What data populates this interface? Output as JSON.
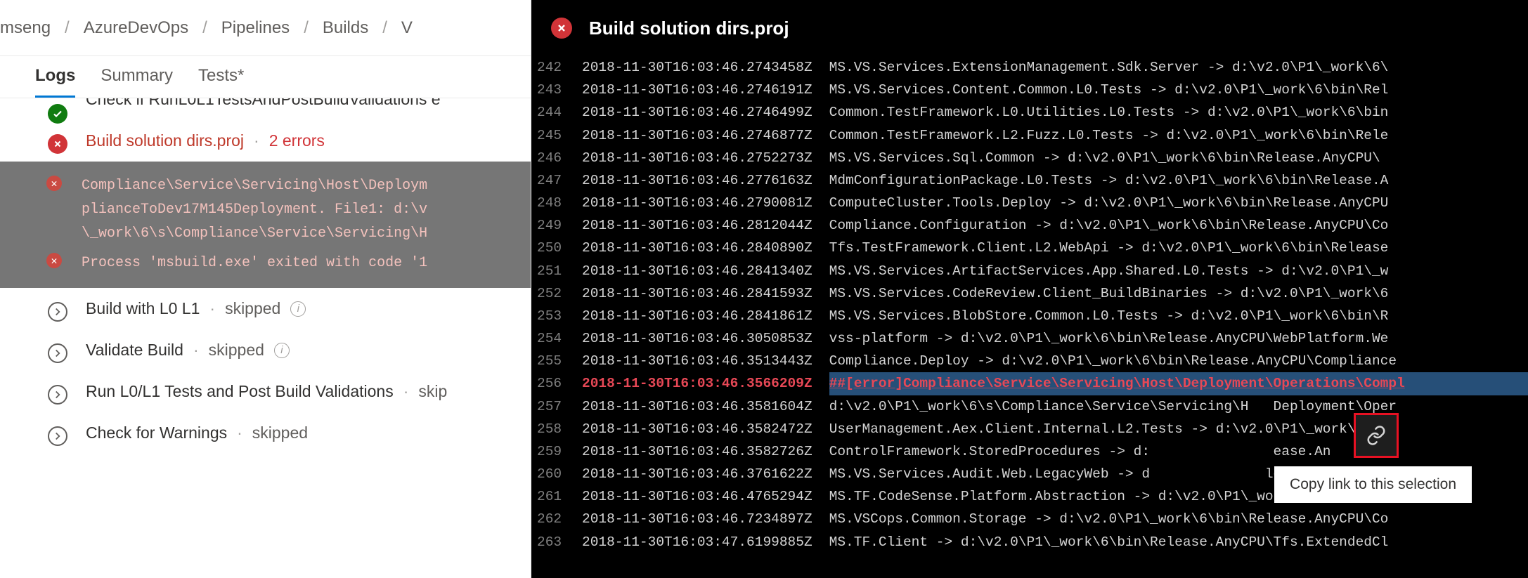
{
  "breadcrumb": [
    "mseng",
    "AzureDevOps",
    "Pipelines",
    "Builds",
    "V"
  ],
  "tabs": {
    "logs": "Logs",
    "summary": "Summary",
    "tests": "Tests*"
  },
  "steps": {
    "cut_prev": "Check if RunL0L1TestsAndPostBuildValidations e",
    "build_solution": {
      "title": "Build solution dirs.proj",
      "errcount": "2 errors"
    },
    "errors": {
      "e1": "Compliance\\Service\\Servicing\\Host\\Deploym\nplianceToDev17M145Deployment. File1: d:\\v\n\\_work\\6\\s\\Compliance\\Service\\Servicing\\H",
      "e2": "Process 'msbuild.exe' exited with code '1"
    },
    "build_l0l1": {
      "title": "Build with L0 L1",
      "status": "skipped"
    },
    "validate_build": {
      "title": "Validate Build",
      "status": "skipped"
    },
    "run_tests": {
      "title": "Run L0/L1 Tests and Post Build Validations",
      "status": "skip"
    },
    "check_warn": {
      "title": "Check for Warnings",
      "status": "skipped"
    }
  },
  "panel_title": "Build solution dirs.proj",
  "log": [
    {
      "n": "242",
      "ts": "2018-11-30T16:03:46.2743458Z",
      "body": "MS.VS.Services.ExtensionManagement.Sdk.Server -> d:\\v2.0\\P1\\_work\\6\\"
    },
    {
      "n": "243",
      "ts": "2018-11-30T16:03:46.2746191Z",
      "body": "MS.VS.Services.Content.Common.L0.Tests -> d:\\v2.0\\P1\\_work\\6\\bin\\Rel"
    },
    {
      "n": "244",
      "ts": "2018-11-30T16:03:46.2746499Z",
      "body": "Common.TestFramework.L0.Utilities.L0.Tests -> d:\\v2.0\\P1\\_work\\6\\bin"
    },
    {
      "n": "245",
      "ts": "2018-11-30T16:03:46.2746877Z",
      "body": "Common.TestFramework.L2.Fuzz.L0.Tests -> d:\\v2.0\\P1\\_work\\6\\bin\\Rele"
    },
    {
      "n": "246",
      "ts": "2018-11-30T16:03:46.2752273Z",
      "body": "MS.VS.Services.Sql.Common -> d:\\v2.0\\P1\\_work\\6\\bin\\Release.AnyCPU\\"
    },
    {
      "n": "247",
      "ts": "2018-11-30T16:03:46.2776163Z",
      "body": "MdmConfigurationPackage.L0.Tests -> d:\\v2.0\\P1\\_work\\6\\bin\\Release.A"
    },
    {
      "n": "248",
      "ts": "2018-11-30T16:03:46.2790081Z",
      "body": "ComputeCluster.Tools.Deploy -> d:\\v2.0\\P1\\_work\\6\\bin\\Release.AnyCPU"
    },
    {
      "n": "249",
      "ts": "2018-11-30T16:03:46.2812044Z",
      "body": "Compliance.Configuration -> d:\\v2.0\\P1\\_work\\6\\bin\\Release.AnyCPU\\Co"
    },
    {
      "n": "250",
      "ts": "2018-11-30T16:03:46.2840890Z",
      "body": "Tfs.TestFramework.Client.L2.WebApi -> d:\\v2.0\\P1\\_work\\6\\bin\\Release"
    },
    {
      "n": "251",
      "ts": "2018-11-30T16:03:46.2841340Z",
      "body": "MS.VS.Services.ArtifactServices.App.Shared.L0.Tests -> d:\\v2.0\\P1\\_w"
    },
    {
      "n": "252",
      "ts": "2018-11-30T16:03:46.2841593Z",
      "body": "MS.VS.Services.CodeReview.Client_BuildBinaries -> d:\\v2.0\\P1\\_work\\6"
    },
    {
      "n": "253",
      "ts": "2018-11-30T16:03:46.2841861Z",
      "body": "MS.VS.Services.BlobStore.Common.L0.Tests -> d:\\v2.0\\P1\\_work\\6\\bin\\R"
    },
    {
      "n": "254",
      "ts": "2018-11-30T16:03:46.3050853Z",
      "body": "vss-platform -> d:\\v2.0\\P1\\_work\\6\\bin\\Release.AnyCPU\\WebPlatform.We"
    },
    {
      "n": "255",
      "ts": "2018-11-30T16:03:46.3513443Z",
      "body": "Compliance.Deploy -> d:\\v2.0\\P1\\_work\\6\\bin\\Release.AnyCPU\\Compliance"
    },
    {
      "n": "256",
      "ts": "2018-11-30T16:03:46.3566209Z",
      "body": "##[error]Compliance\\Service\\Servicing\\Host\\Deployment\\Operations\\Compl",
      "err": true,
      "sel": true
    },
    {
      "n": "257",
      "ts": "2018-11-30T16:03:46.3581604Z",
      "body": "d:\\v2.0\\P1\\_work\\6\\s\\Compliance\\Service\\Servicing\\H   Deployment\\Oper"
    },
    {
      "n": "258",
      "ts": "2018-11-30T16:03:46.3582472Z",
      "body": "UserManagement.Aex.Client.Internal.L2.Tests -> d:\\v2.0\\P1\\_work\\6\\bi"
    },
    {
      "n": "259",
      "ts": "2018-11-30T16:03:46.3582726Z",
      "body": "ControlFramework.StoredProcedures -> d:               ease.An"
    },
    {
      "n": "260",
      "ts": "2018-11-30T16:03:46.3761622Z",
      "body": "MS.VS.Services.Audit.Web.LegacyWeb -> d              lease.A"
    },
    {
      "n": "261",
      "ts": "2018-11-30T16:03:46.4765294Z",
      "body": "MS.TF.CodeSense.Platform.Abstraction -> d:\\v2.0\\P1\\_work\\6\\bin\\Relea"
    },
    {
      "n": "262",
      "ts": "2018-11-30T16:03:46.7234897Z",
      "body": "MS.VSCops.Common.Storage -> d:\\v2.0\\P1\\_work\\6\\bin\\Release.AnyCPU\\Co"
    },
    {
      "n": "263",
      "ts": "2018-11-30T16:03:47.6199885Z",
      "body": "MS.TF.Client -> d:\\v2.0\\P1\\_work\\6\\bin\\Release.AnyCPU\\Tfs.ExtendedCl"
    }
  ],
  "tooltip": "Copy link to this selection"
}
